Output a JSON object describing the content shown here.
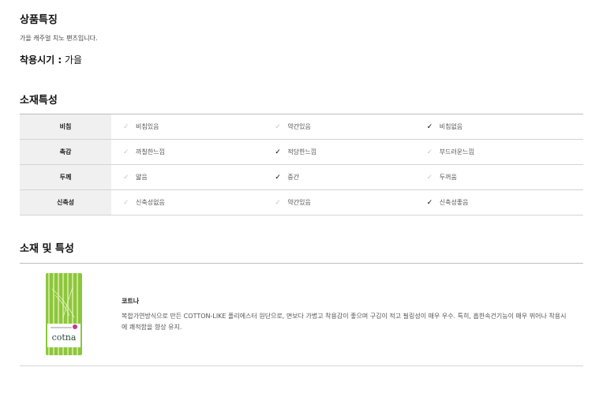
{
  "features": {
    "heading": "상품특징",
    "description": "가을 캐주얼 치노 팬츠입니다.",
    "season_label": "착용시기 :",
    "season_value": "가을"
  },
  "material_props": {
    "heading": "소재특성",
    "rows": [
      {
        "label": "비침",
        "options": [
          "비침있음",
          "약간있음",
          "비침없음"
        ],
        "selected": 2
      },
      {
        "label": "촉감",
        "options": [
          "까칠한느낌",
          "적당한느낌",
          "부드러운느낌"
        ],
        "selected": 1
      },
      {
        "label": "두께",
        "options": [
          "얇음",
          "중간",
          "두꺼움"
        ],
        "selected": 1
      },
      {
        "label": "신축성",
        "options": [
          "신축성없음",
          "약간있음",
          "신축성좋음"
        ],
        "selected": 2
      }
    ]
  },
  "materials": {
    "heading": "소재 및 특성",
    "fabric_name": "코트나",
    "fabric_desc": "복합가연방식으로 만든 COTTON-LIKE 폴리에스터 원단으로, 면보다 가볍고 착용감이 좋으며 구김이 적고 필링성이 매우 우수. 특히, 흡한속건기능이 매우 뛰어나 착용시에 쾌적함을 향상 유지.",
    "logo_text": "cotna"
  },
  "colors": {
    "check_on": "#000000",
    "check_off": "#c6c6c6",
    "label_bg": "#f0f0f0",
    "logo_green": "#8cc63f"
  }
}
